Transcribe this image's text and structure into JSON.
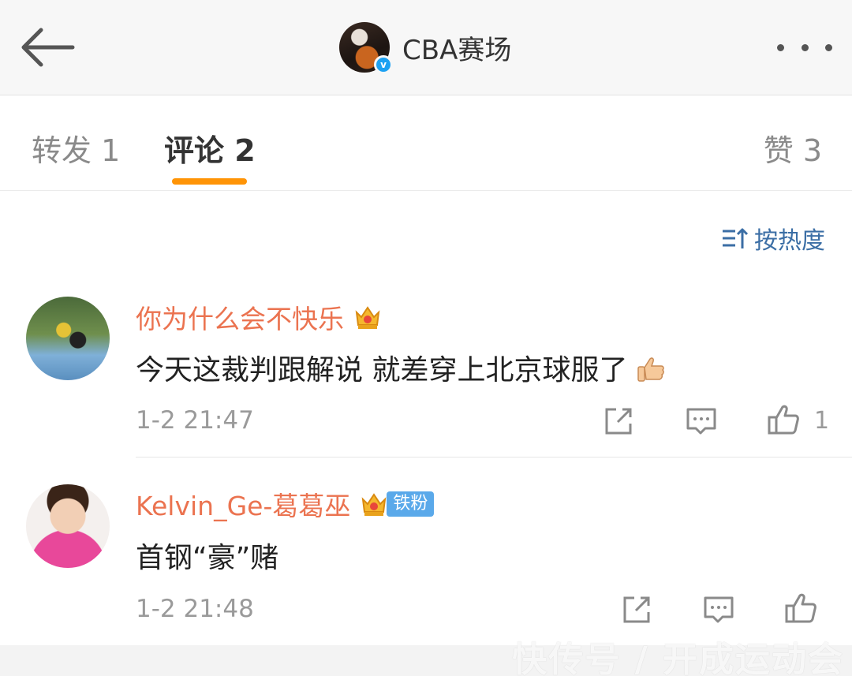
{
  "header": {
    "title": "CBA赛场",
    "verified_mark": "v"
  },
  "tabs": {
    "repost": "转发 1",
    "comment": "评论 2",
    "like": "赞 3"
  },
  "sort": {
    "label": "按热度"
  },
  "comments": [
    {
      "user": "你为什么会不快乐",
      "text": "今天这裁判跟解说 就差穿上北京球服了",
      "time": "1-2 21:47",
      "likes": "1"
    },
    {
      "user": "Kelvin_Ge-葛葛巫",
      "badge": "铁粉",
      "text": "首钢“豪”赌",
      "time": "1-2 21:48"
    }
  ],
  "watermark": "快传号 / 开成运动会",
  "colors": {
    "accent": "#ff9406",
    "username": "#eb7350",
    "sort": "#3b6ea5",
    "badge": "#5aa9ea"
  }
}
